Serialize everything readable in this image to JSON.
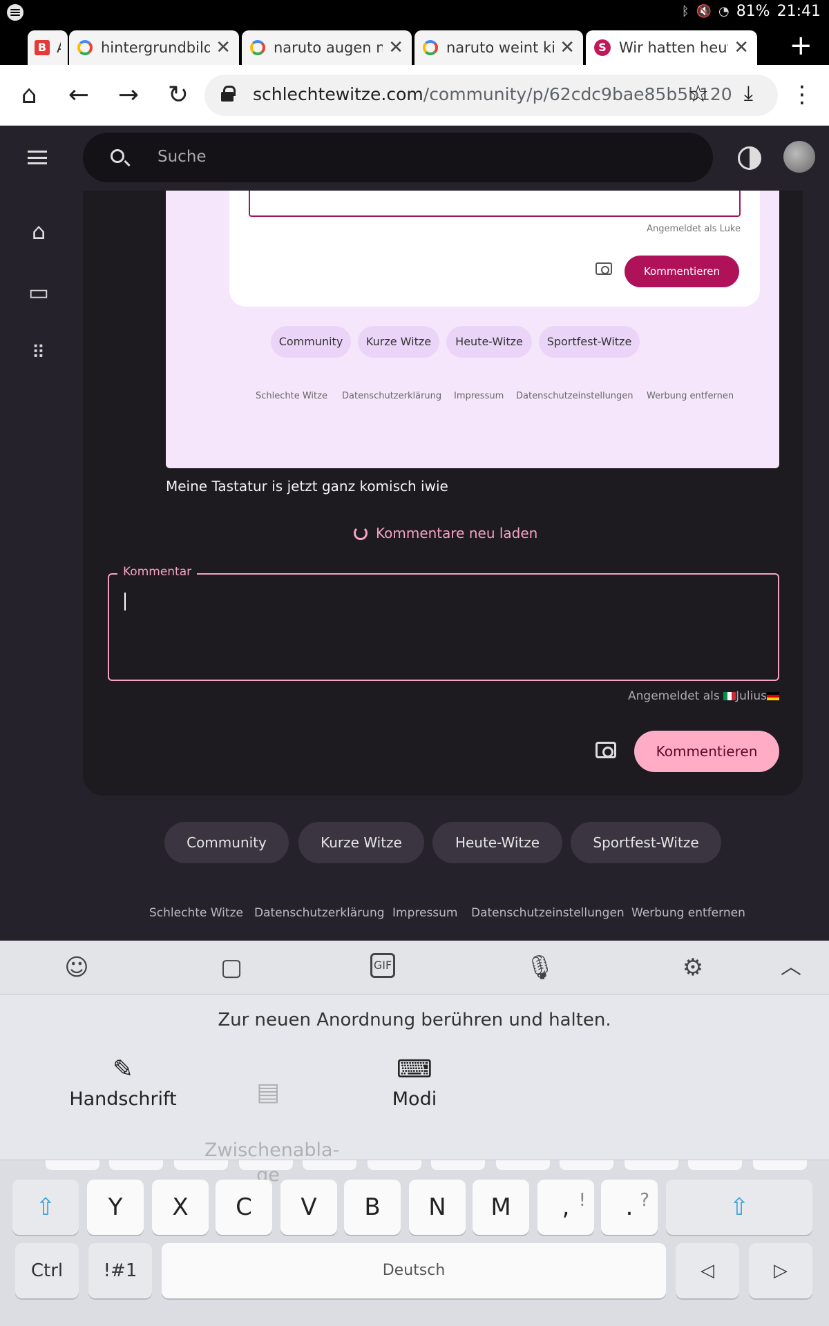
{
  "status_bar": {
    "battery": "81%",
    "time": "21:41"
  },
  "tabs": [
    {
      "label": "A",
      "favicon": "b-icon"
    },
    {
      "label": "hintergrundbilde"
    },
    {
      "label": "naruto augen na"
    },
    {
      "label": "naruto weint kin"
    },
    {
      "label": "Wir hatten heute",
      "active": true
    }
  ],
  "url_bar": {
    "domain": "schlechtewitze.com",
    "path": "/community/p/62cdc9bae85b5b120"
  },
  "search": {
    "placeholder": "Suche"
  },
  "embed": {
    "logged_in_as": "Angemeldet als Luke",
    "comment_button": "Kommentieren",
    "chips": [
      "Community",
      "Kurze Witze",
      "Heute-Witze",
      "Sportfest-Witze"
    ],
    "footer_links": [
      "Schlechte Witze",
      "Datenschutzerklärung",
      "Impressum",
      "Datenschutzeinstellungen",
      "Werbung entfernen"
    ]
  },
  "comment_text": "Meine Tastatur is jetzt ganz komisch iwie",
  "reload_label": "Kommentare neu laden",
  "comment_form": {
    "label": "Kommentar",
    "value": "",
    "logged_in_prefix": "Angemeldet als ",
    "username": "Julius",
    "submit_label": "Kommentieren"
  },
  "chips": [
    "Community",
    "Kurze Witze",
    "Heute-Witze",
    "Sportfest-Witze"
  ],
  "footer_links": [
    "Schlechte Witze",
    "Datenschutzerklärung",
    "Impressum",
    "Datenschutzeinstellungen",
    "Werbung entfernen"
  ],
  "keyboard": {
    "hint": "Zur neuen Anordnung berühren und halten.",
    "modes": [
      "Handschrift",
      "Zwischenabla-\nge",
      "Modi"
    ],
    "row_letters": [
      "Y",
      "X",
      "C",
      "V",
      "B",
      "N",
      "M"
    ],
    "comma_key": {
      "main": ",",
      "alt": "!"
    },
    "period_key": {
      "main": ".",
      "alt": "?"
    },
    "ctrl": "Ctrl",
    "symbols": "!#1",
    "space": "Deutsch"
  },
  "colors": {
    "accent": "#ffadc6",
    "embed_accent": "#b0125a",
    "background": "#26222b"
  }
}
